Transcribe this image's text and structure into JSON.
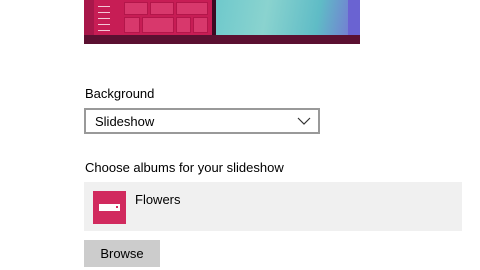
{
  "preview": {
    "colors": {
      "accent": "#c71d55",
      "taskbar": "#5b1031",
      "wallpaper": "#6fc9cc"
    }
  },
  "background": {
    "label": "Background",
    "selected": "Slideshow",
    "dropdown_icon": "chevron-down-icon"
  },
  "albums": {
    "label": "Choose albums for your slideshow",
    "items": [
      {
        "name": "Flowers",
        "icon": "folder-thumbnail-icon"
      }
    ],
    "browse_label": "Browse"
  }
}
